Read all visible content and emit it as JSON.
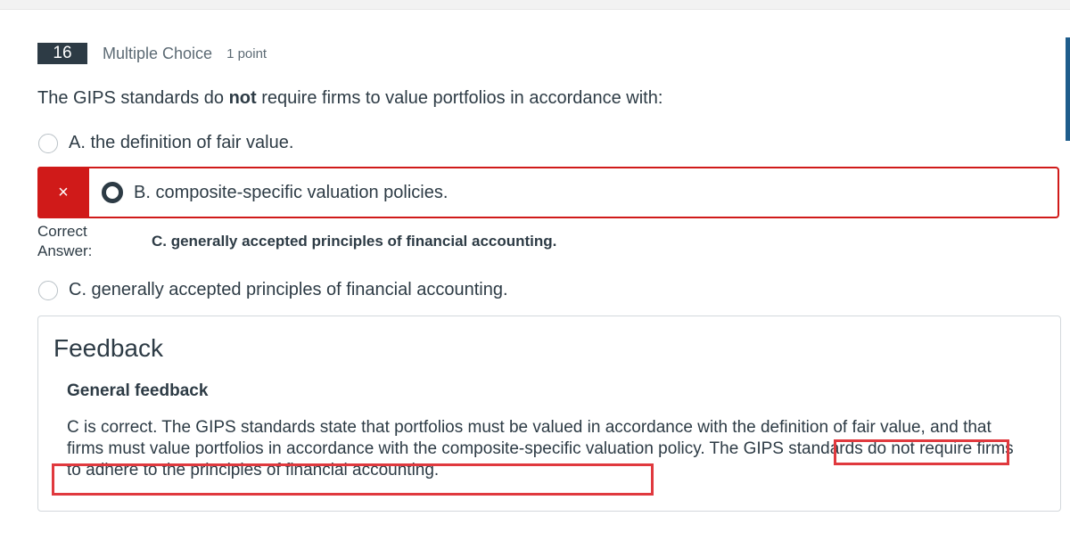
{
  "question": {
    "number": "16",
    "type": "Multiple Choice",
    "points": "1 point",
    "text_before": "The GIPS standards do ",
    "text_bold": "not",
    "text_after": " require firms to value portfolios in accordance with:"
  },
  "options": [
    {
      "label": "A. the definition of fair value.",
      "selected": false
    },
    {
      "label": "B. composite-specific valuation policies.",
      "selected": true,
      "status": "incorrect"
    },
    {
      "label": "C. generally accepted principles of financial accounting.",
      "selected": false
    }
  ],
  "result": {
    "wrong_icon": "×",
    "correct_label_line1": "Correct",
    "correct_label_line2": "Answer:",
    "correct_answer": "C. generally accepted principles of financial accounting."
  },
  "feedback": {
    "title": "Feedback",
    "subtitle": "General feedback",
    "body": "C is correct. The GIPS standards state that portfolios must be valued in accordance with the definition of fair value, and that firms must value portfolios in accordance with the composite-specific valuation policy. The GIPS standards do not require firms to adhere to the principles of financial accounting."
  },
  "colors": {
    "incorrect": "#d01a19",
    "highlight": "#e0393e",
    "text": "#2d3b45",
    "accent": "#1f5d8c"
  }
}
